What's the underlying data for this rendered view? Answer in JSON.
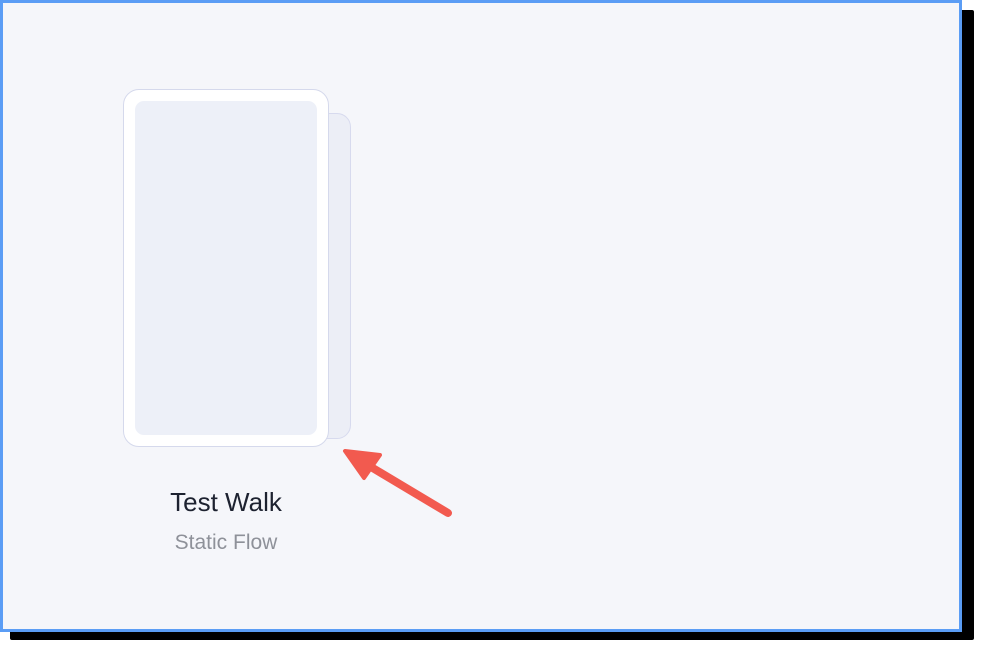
{
  "flow_card": {
    "title": "Test Walk",
    "subtitle": "Static Flow"
  },
  "colors": {
    "frame_border": "#5b9df5",
    "canvas_background": "#f5f6fa",
    "annotation_arrow": "#f25a4f"
  },
  "icons": {
    "annotation": "arrow-icon"
  }
}
